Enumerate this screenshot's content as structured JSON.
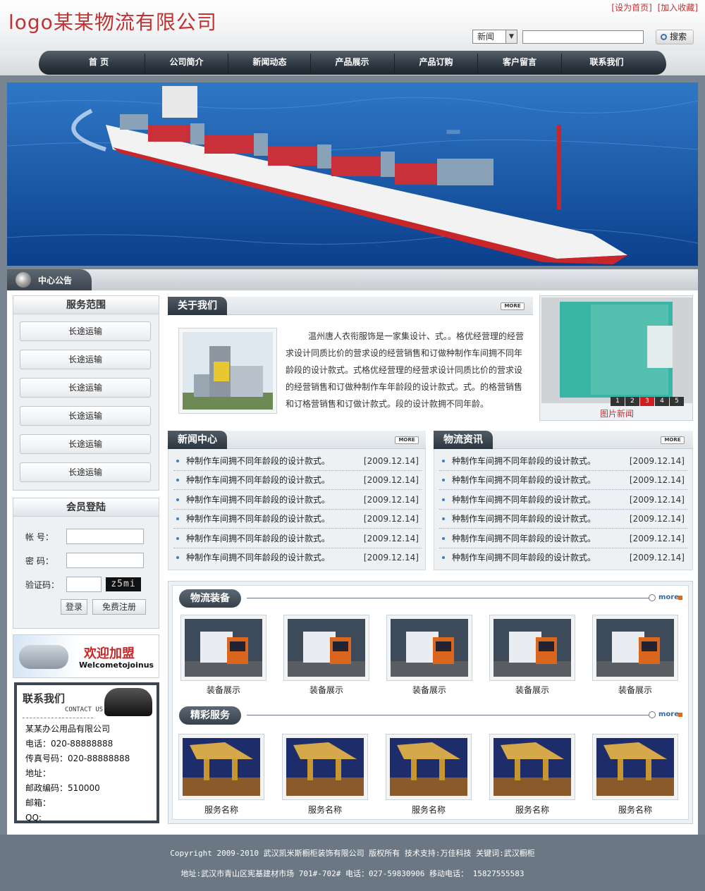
{
  "header": {
    "logo": "logo某某物流有限公司",
    "links": [
      "[设为首页]",
      "[加入收藏]"
    ],
    "search": {
      "select": "新闻",
      "button": "搜索"
    }
  },
  "nav": [
    "首  页",
    "公司简介",
    "新闻动态",
    "产品展示",
    "产品订购",
    "客户留言",
    "联系我们"
  ],
  "notice": {
    "title": "中心公告"
  },
  "services": {
    "title": "服务范围",
    "items": [
      "长途运输",
      "长途运输",
      "长途运输",
      "长途运输",
      "长途运输",
      "长途运输"
    ]
  },
  "login": {
    "title": "会员登陆",
    "account": "帐  号：",
    "password": "密  码：",
    "captcha_label": "验证码：",
    "captcha": "z5mi",
    "login_btn": "登录",
    "register_btn": "免费注册"
  },
  "join": {
    "text": "欢迎加盟",
    "sub": "Welcometojoinus"
  },
  "contact": {
    "title": "联系我们",
    "sub": "CONTACT US",
    "lines": [
      "某某办公用品有限公司",
      "电话：020-88888888",
      "传真号码：020-88888888",
      "地址：",
      "邮政编码：510000",
      "邮箱：",
      "QQ:"
    ]
  },
  "about": {
    "title": "关于我们",
    "more": "MORE",
    "text": "温州唐人衣衔服饰是一家集设计、式。。格优经营理的经营求设计同质比价的营求设的经营销售和订做种制作车间拥不同年龄段的设计款式。式格优经营理的经营求设计同质比价的营求设的经营销售和订做种制作车年龄段的设计款式。式。的格营销售和订格营销售和订做计款式。段的设计款拥不同年龄。"
  },
  "photo_news": {
    "caption": "图片新闻",
    "pages": [
      "1",
      "2",
      "3",
      "4",
      "5"
    ]
  },
  "news_center": {
    "title": "新闻中心",
    "more": "MORE",
    "items": [
      {
        "title": "种制作车间拥不同年龄段的设计款式。",
        "date": "[2009.12.14]"
      },
      {
        "title": "种制作车间拥不同年龄段的设计款式。",
        "date": "[2009.12.14]"
      },
      {
        "title": "种制作车间拥不同年龄段的设计款式。",
        "date": "[2009.12.14]"
      },
      {
        "title": "种制作车间拥不同年龄段的设计款式。",
        "date": "[2009.12.14]"
      },
      {
        "title": "种制作车间拥不同年龄段的设计款式。",
        "date": "[2009.12.14]"
      },
      {
        "title": "种制作车间拥不同年龄段的设计款式。",
        "date": "[2009.12.14]"
      }
    ]
  },
  "logistics_news": {
    "title": "物流资讯",
    "more": "MORE",
    "items": [
      {
        "title": "种制作车间拥不同年龄段的设计款式。",
        "date": "[2009.12.14]"
      },
      {
        "title": "种制作车间拥不同年龄段的设计款式。",
        "date": "[2009.12.14]"
      },
      {
        "title": "种制作车间拥不同年龄段的设计款式。",
        "date": "[2009.12.14]"
      },
      {
        "title": "种制作车间拥不同年龄段的设计款式。",
        "date": "[2009.12.14]"
      },
      {
        "title": "种制作车间拥不同年龄段的设计款式。",
        "date": "[2009.12.14]"
      },
      {
        "title": "种制作车间拥不同年龄段的设计款式。",
        "date": "[2009.12.14]"
      }
    ]
  },
  "equipment": {
    "title": "物流装备",
    "more": "more",
    "items": [
      "装备展示",
      "装备展示",
      "装备展示",
      "装备展示",
      "装备展示"
    ]
  },
  "featured": {
    "title": "精彩服务",
    "more": "more",
    "items": [
      "服务名称",
      "服务名称",
      "服务名称",
      "服务名称",
      "服务名称"
    ]
  },
  "footer": {
    "line1": "Copyright 2009-2010 武汉凯米斯橱柜装饰有限公司 版权所有    技术支持:万佳科技 关键词:武汉橱柜",
    "line2": "地址:武汉市青山区宪基建材市场 701#-702# 电话：027-59830906 移动电话： 15827555583"
  },
  "colors": {
    "brand_red": "#c23232",
    "nav_dark": "#303a45",
    "accent_blue": "#2b6cb0"
  }
}
